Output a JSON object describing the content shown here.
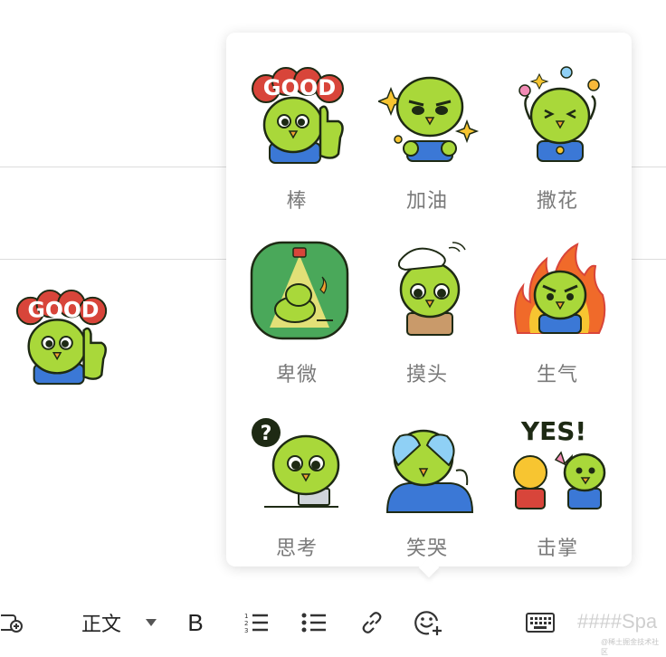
{
  "stickers": [
    {
      "label": "棒",
      "icon": "thumbs-up-good-sticker"
    },
    {
      "label": "加油",
      "icon": "cheer-sticker"
    },
    {
      "label": "撒花",
      "icon": "flowers-sticker"
    },
    {
      "label": "卑微",
      "icon": "humble-sticker"
    },
    {
      "label": "摸头",
      "icon": "pat-head-sticker"
    },
    {
      "label": "生气",
      "icon": "angry-sticker"
    },
    {
      "label": "思考",
      "icon": "thinking-sticker"
    },
    {
      "label": "笑哭",
      "icon": "laugh-cry-sticker"
    },
    {
      "label": "击掌",
      "icon": "high-five-sticker"
    }
  ],
  "sticker_texts": {
    "good": "GOOD",
    "yes": "YES!",
    "question": "?"
  },
  "toolbar": {
    "text_style": "正文",
    "bold": "B",
    "placeholder": "####Spa",
    "watermark": "@稀土掘金技术社区"
  },
  "colors": {
    "bird_green": "#a9d83a",
    "outline": "#1e2a14",
    "shirt_blue": "#3b78d6",
    "good_red": "#d8453a"
  }
}
